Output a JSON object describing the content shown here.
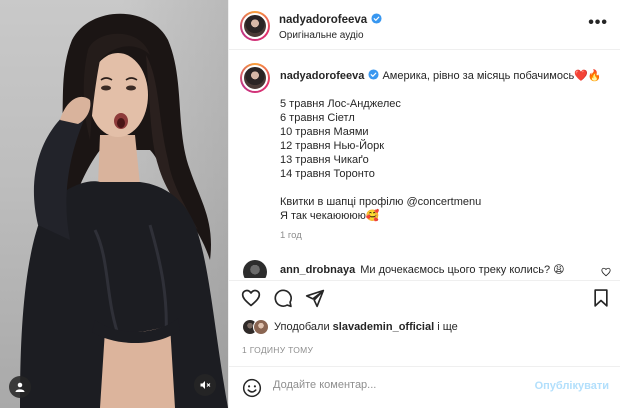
{
  "post": {
    "username": "nadyadorofeeva",
    "audio": "Оригінальне аудіо",
    "more": "•••"
  },
  "caption": {
    "username": "nadyadorofeeva",
    "headline": "Америка, рівно за місяць побачимось❤️🔥",
    "tour": [
      "5 травня Лос-Анджелес",
      "6 травня Сіетл",
      "10 травня Маями",
      "12 травня Нью-Йорк",
      "13 травня Чикаґо",
      "14 травня Торонто"
    ],
    "tickets": "Квитки в шапці профілю @concertmenu",
    "excited": "Я так чекаюююю🥰",
    "time": "1 год"
  },
  "comment": {
    "username": "ann_drobnaya",
    "text": "Ми дочекаємось цього треку колись? 😩"
  },
  "likes": {
    "prefix": "Уподобали",
    "user": "slavademin_official",
    "suffix": "і ще"
  },
  "post_time": "1 ГОДИНУ ТОМУ",
  "add_comment": {
    "placeholder": "Додайте коментар...",
    "post_button": "Опублікувати"
  },
  "colors": {
    "verified": "#3897f0",
    "like_red": "#ed4956",
    "post_button_disabled": "#b2dffc"
  },
  "icons": [
    "user-tag-icon",
    "mute-icon",
    "verified-icon",
    "more-icon",
    "heart-icon",
    "comment-icon",
    "share-icon",
    "bookmark-icon",
    "emoji-icon"
  ]
}
